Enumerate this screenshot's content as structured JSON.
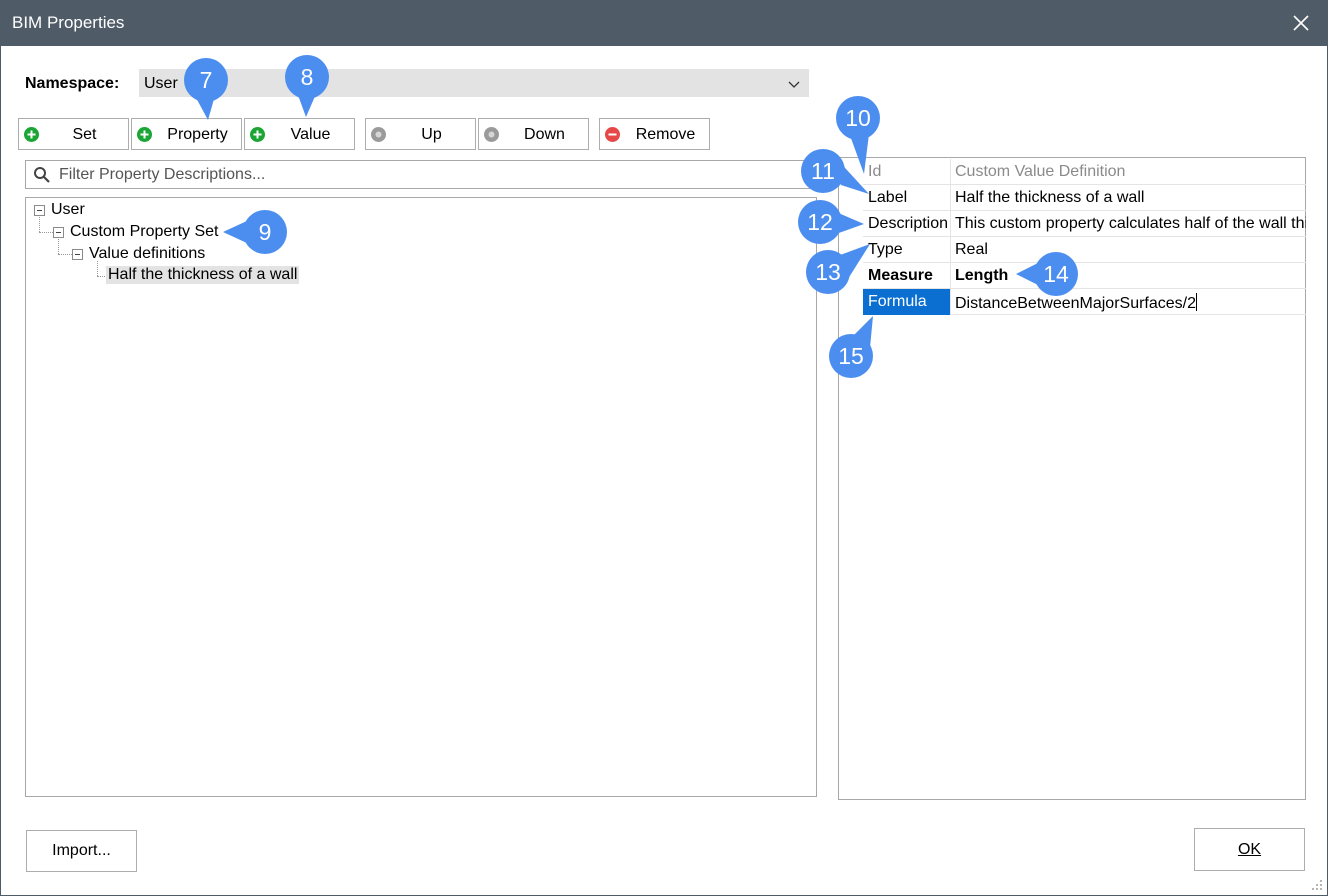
{
  "window": {
    "title": "BIM Properties"
  },
  "namespace": {
    "label": "Namespace:",
    "value": "User"
  },
  "toolbar": {
    "set": "Set",
    "property": "Property",
    "value": "Value",
    "up": "Up",
    "down": "Down",
    "remove": "Remove"
  },
  "filter": {
    "placeholder": "Filter Property Descriptions..."
  },
  "tree": {
    "root": "User",
    "set": "Custom Property Set",
    "group": "Value definitions",
    "item": "Half the thickness of a wall"
  },
  "grid": {
    "rows": [
      {
        "name": "Id",
        "value": "Custom Value Definition"
      },
      {
        "name": "Label",
        "value": "Half the thickness of a wall"
      },
      {
        "name": "Description",
        "value": "This custom property calculates half of the wall thickness"
      },
      {
        "name": "Type",
        "value": "Real"
      },
      {
        "name": "Measure",
        "value": "Length"
      },
      {
        "name": "Formula",
        "value": "DistanceBetweenMajorSurfaces/2"
      }
    ]
  },
  "footer": {
    "import": "Import...",
    "ok": "OK"
  },
  "callouts": [
    "7",
    "8",
    "9",
    "10",
    "11",
    "12",
    "13",
    "14",
    "15"
  ],
  "colors": {
    "titlebar": "#4f5b66",
    "callout": "#4b8ef0",
    "selection": "#0a6fd1",
    "add_icon": "#1aa534",
    "remove_icon": "#e64848"
  }
}
